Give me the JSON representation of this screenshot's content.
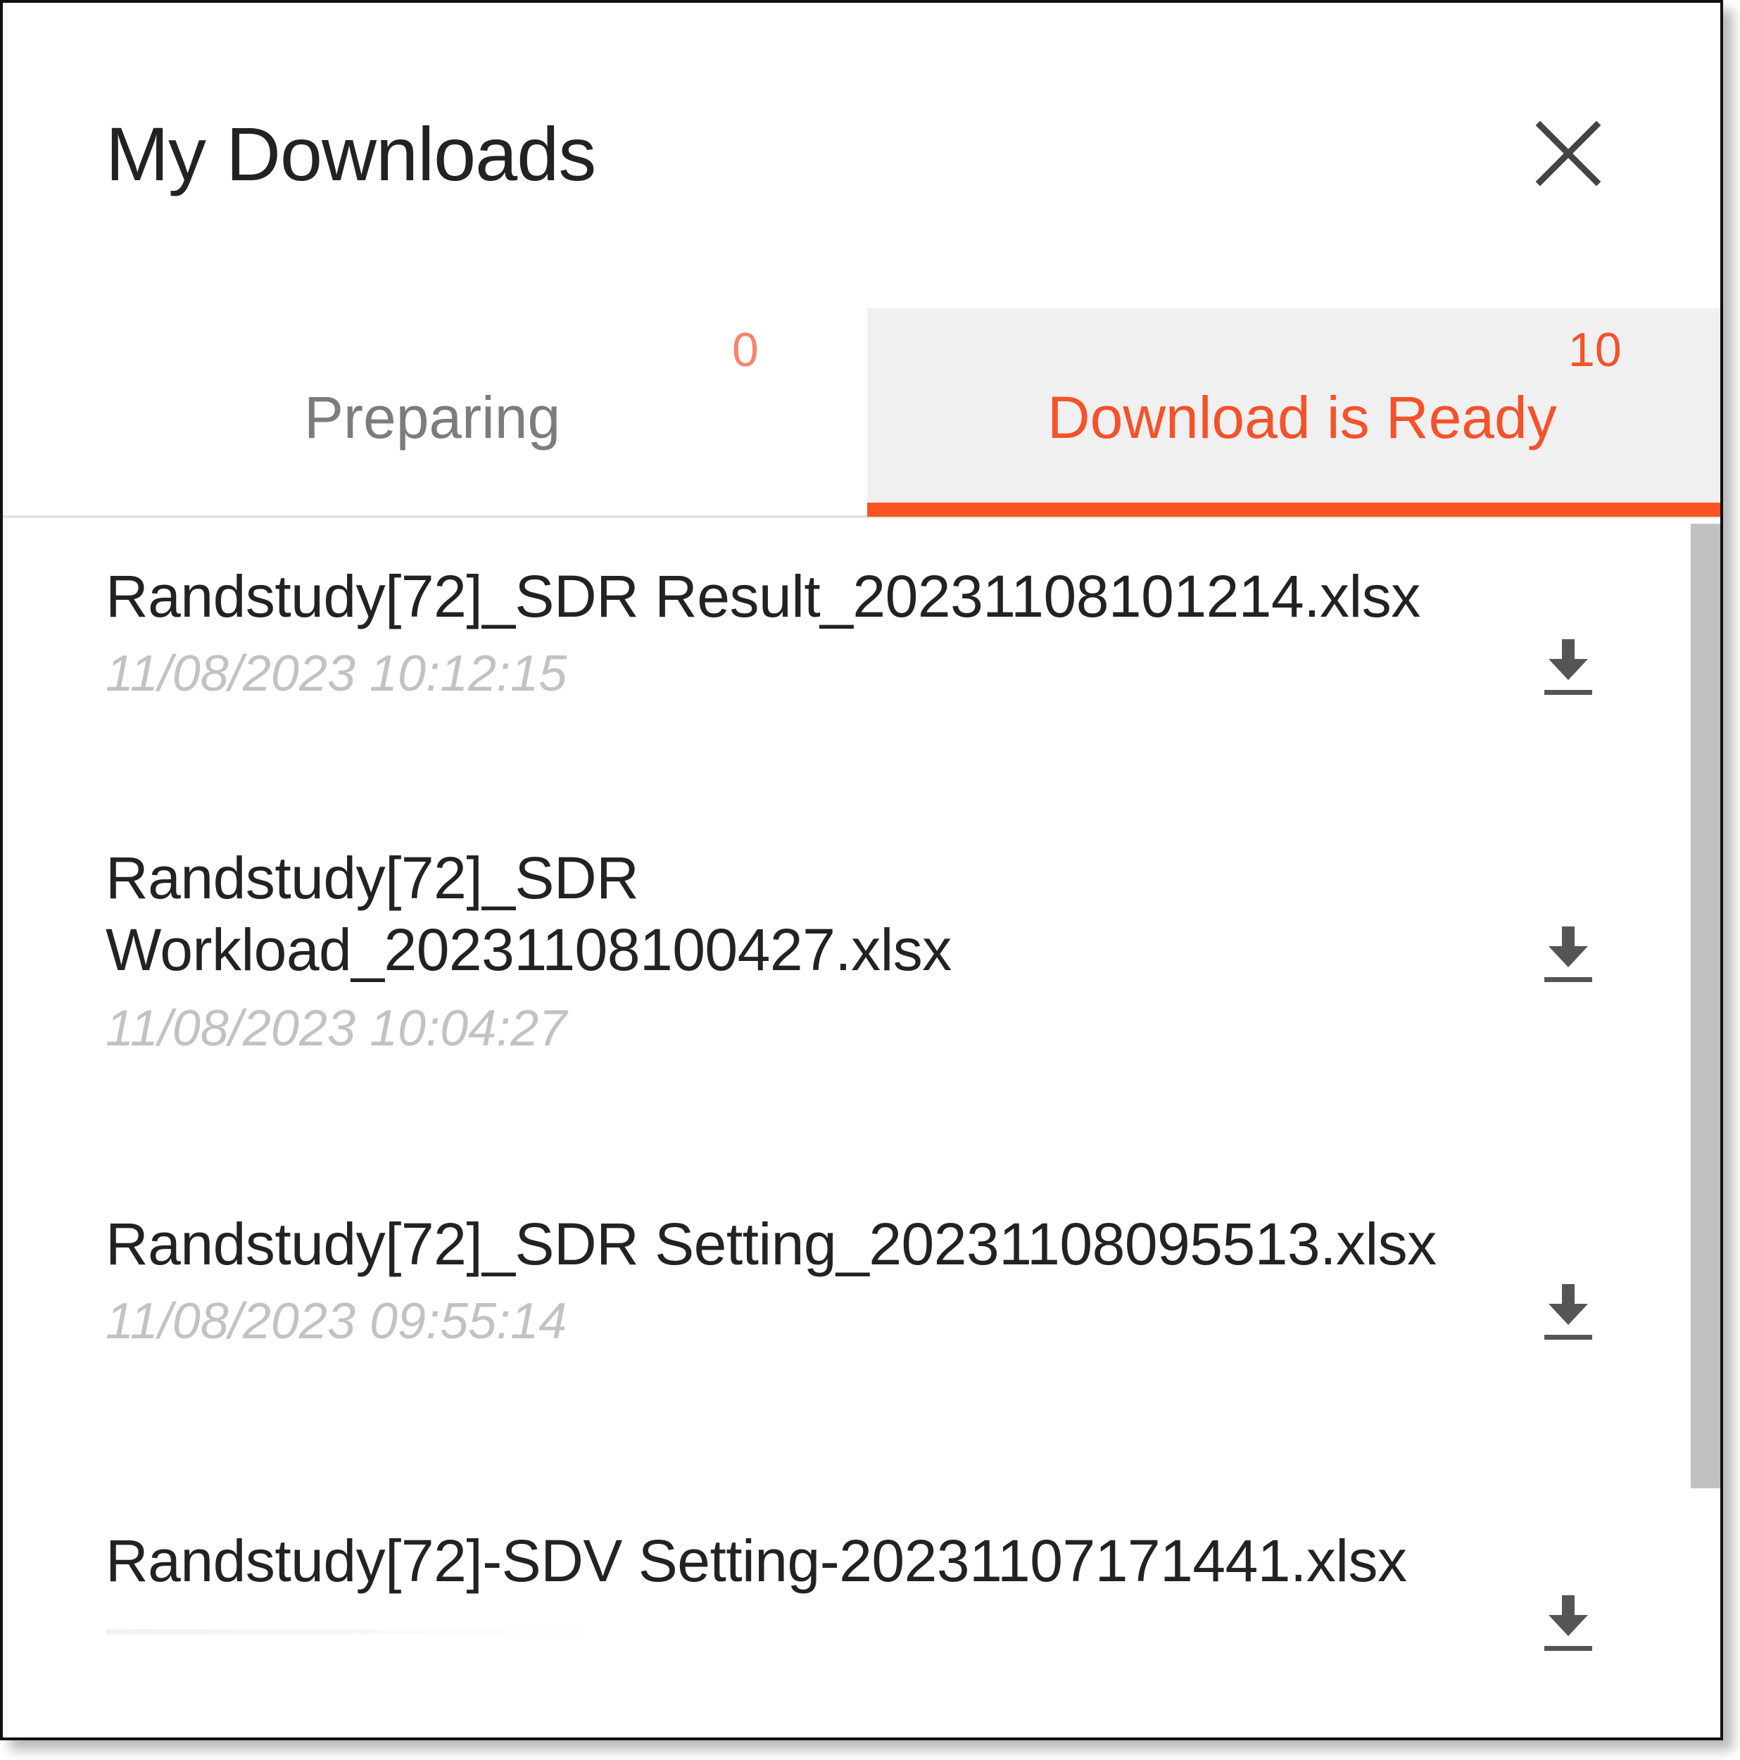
{
  "header": {
    "title": "My Downloads",
    "close_icon": "close-icon"
  },
  "tabs": [
    {
      "label": "Preparing",
      "count": "0",
      "active": false
    },
    {
      "label": "Download is Ready",
      "count": "10",
      "active": true
    }
  ],
  "colors": {
    "accent": "#fa5424",
    "active_tab_bg": "#f0f0f1",
    "date_text": "#c2c2c2",
    "title_text": "#222222"
  },
  "downloads": [
    {
      "name": "Randstudy[72]_SDR Result_20231108101214.xlsx",
      "date": "11/08/2023 10:12:15",
      "icon": "download-icon"
    },
    {
      "name": "Randstudy[72]_SDR Workload_20231108100427.xlsx",
      "date": "11/08/2023 10:04:27",
      "icon": "download-icon"
    },
    {
      "name": "Randstudy[72]_SDR Setting_20231108095513.xlsx",
      "date": "11/08/2023 09:55:14",
      "icon": "download-icon"
    },
    {
      "name": "Randstudy[72]-SDV Setting-20231107171441.xlsx",
      "date": "",
      "icon": "download-icon"
    }
  ]
}
